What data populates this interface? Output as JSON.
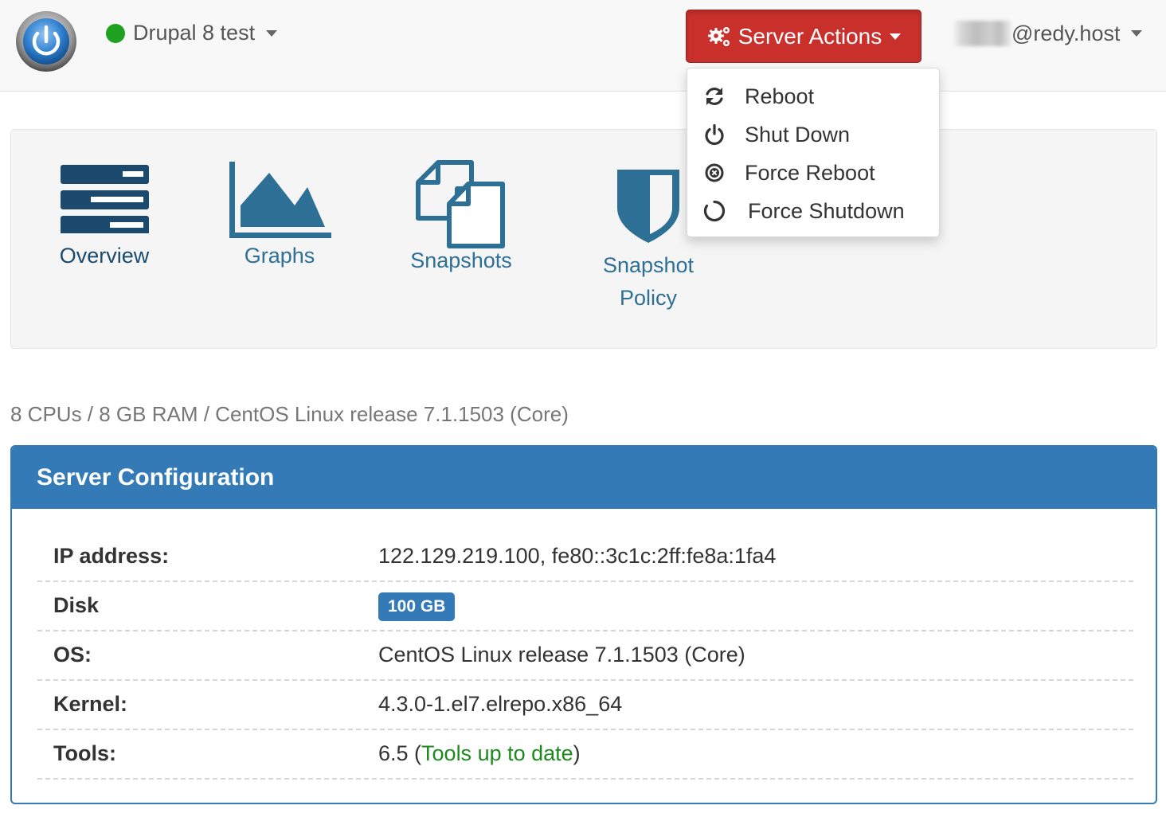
{
  "header": {
    "server_name": "Drupal 8 test",
    "server_status_color": "#1fa21f",
    "server_actions_label": "Server Actions",
    "user_label": "@redy.host"
  },
  "server_actions_menu": [
    {
      "label": "Reboot",
      "icon": "refresh-icon"
    },
    {
      "label": "Shut Down",
      "icon": "power-icon"
    },
    {
      "label": "Force Reboot",
      "icon": "times-circle-icon"
    },
    {
      "label": "Force Shutdown",
      "icon": "circle-outline-icon"
    }
  ],
  "nav_tiles": [
    {
      "label": "Overview",
      "icon": "server-stack-icon",
      "active": true
    },
    {
      "label": "Graphs",
      "icon": "area-chart-icon"
    },
    {
      "label": "Snapshots",
      "icon": "files-icon"
    },
    {
      "label": "Snapshot Policy",
      "icon": "shield-icon"
    }
  ],
  "spec_summary": "8 CPUs / 8 GB RAM / CentOS Linux release 7.1.1503 (Core)",
  "config": {
    "title": "Server Configuration",
    "rows": [
      {
        "key": "IP address:",
        "value": "122.129.219.100, fe80::3c1c:2ff:fe8a:1fa4"
      },
      {
        "key": "Disk",
        "badge": "100 GB"
      },
      {
        "key": "OS:",
        "value": "CentOS Linux release 7.1.1503 (Core)"
      },
      {
        "key": "Kernel:",
        "value": "4.3.0-1.el7.elrepo.x86_64"
      },
      {
        "key": "Tools:",
        "value_prefix": "6.5 (",
        "value_status": "Tools up to date",
        "value_suffix": ")"
      }
    ]
  },
  "colors": {
    "primary": "#337ab7",
    "danger": "#c9302c",
    "success": "#1d8a1d",
    "link": "#2e6f95"
  }
}
